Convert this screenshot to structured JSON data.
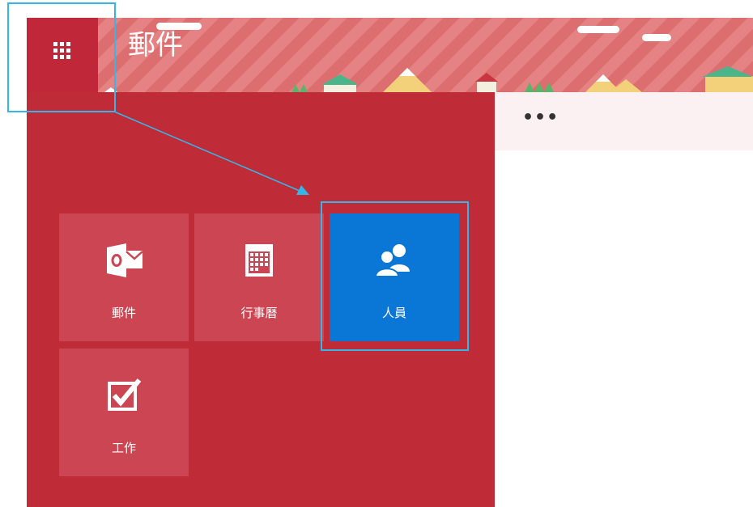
{
  "header": {
    "app_title": "郵件",
    "waffle_icon": "app-launcher-grid-icon",
    "theme_colors": {
      "brand_red": "#c0283a",
      "stripe_light": "#e58284",
      "stripe_dark": "#dd6e70"
    }
  },
  "toolbar": {
    "more_label": "•••"
  },
  "launcher": {
    "background": "#c02b38",
    "tiles": [
      {
        "label": "郵件",
        "icon": "outlook-mail-icon",
        "selected": false
      },
      {
        "label": "行事曆",
        "icon": "calendar-icon",
        "selected": false
      },
      {
        "label": "人員",
        "icon": "people-icon",
        "selected": true
      },
      {
        "label": "工作",
        "icon": "tasks-checkbox-icon",
        "selected": false
      }
    ],
    "selected_color": "#0a76d6"
  },
  "annotation": {
    "highlight_color": "#35b6e8"
  }
}
